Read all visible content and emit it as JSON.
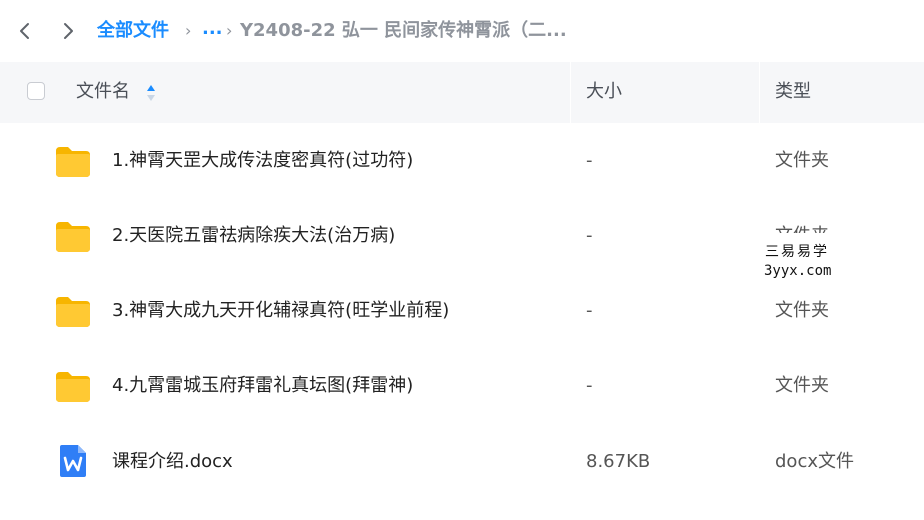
{
  "breadcrumb": {
    "root": "全部文件",
    "ellipsis": "...",
    "current": "Y2408-22 弘一 民间家传神霄派（二..."
  },
  "table": {
    "headers": {
      "name": "文件名",
      "size": "大小",
      "type": "类型"
    },
    "rows": [
      {
        "icon": "folder-icon",
        "name": "1.神霄天罡大成传法度密真符(过功符)",
        "size": "-",
        "type": "文件夹"
      },
      {
        "icon": "folder-icon",
        "name": "2.天医院五雷祛病除疾大法(治万病)",
        "size": "-",
        "type": "文件夹"
      },
      {
        "icon": "folder-icon",
        "name": "3.神霄大成九天开化辅禄真符(旺学业前程)",
        "size": "-",
        "type": "文件夹"
      },
      {
        "icon": "folder-icon",
        "name": "4.九霄雷城玉府拜雷礼真坛图(拜雷神)",
        "size": "-",
        "type": "文件夹"
      },
      {
        "icon": "word-doc-icon",
        "name": "课程介绍.docx",
        "size": "8.67KB",
        "type": "docx文件"
      }
    ]
  },
  "watermark": {
    "line1": "三易易学",
    "line2": "3yyx.com"
  },
  "colors": {
    "accent": "#1a8cff",
    "folder": "#ffc933",
    "doc": "#2f7ef6",
    "header_bg": "#f6f7f9",
    "muted": "#8f949c"
  }
}
